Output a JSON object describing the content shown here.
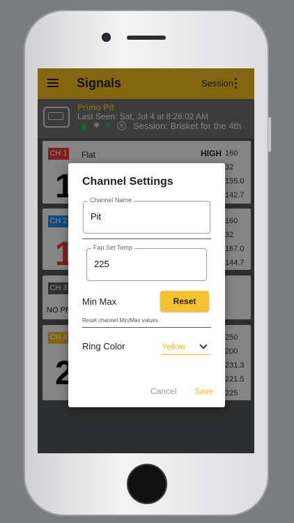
{
  "appbar": {
    "title": "Signals",
    "session_label": "Session"
  },
  "device": {
    "name": "Primo Pit",
    "last_seen": "Last Seen: Sat, Jul 4 at 8:28:02 AM",
    "session": "Session: Brisket for the 4th",
    "bt_glyph": "✱",
    "wifi_glyph": "≋",
    "fan_glyph": "✲"
  },
  "channels": [
    {
      "badge": "CH 1",
      "color": "#e53935",
      "label": "Flat",
      "big": "1",
      "high": "HIGH",
      "vals": [
        "160",
        "32",
        "155.0",
        "142.7"
      ]
    },
    {
      "badge": "CH 2",
      "color": "#1e88e5",
      "label": "",
      "big": "1",
      "vals": [
        "160",
        "32",
        "167.0",
        "144.7"
      ]
    },
    {
      "badge": "CH 3",
      "color": "#5a5a5a",
      "label": "",
      "noprobe": "NO PR",
      "vals": []
    },
    {
      "badge": "CH 4",
      "color": "#f3ba1e",
      "label": "",
      "big": "2",
      "vals": [
        "250",
        "200",
        "231.3",
        "221.5",
        "225"
      ]
    }
  ],
  "dialog": {
    "title": "Channel Settings",
    "channel_name_label": "Channel Name",
    "channel_name_value": "Pit",
    "fan_label": "Fan Set Temp",
    "fan_value": "225",
    "minmax_label": "Min Max",
    "reset_label": "Reset",
    "reset_helper": "Reset channel Min/Max values",
    "ring_label": "Ring Color",
    "ring_value": "Yellow",
    "cancel": "Cancel",
    "save": "Save"
  }
}
